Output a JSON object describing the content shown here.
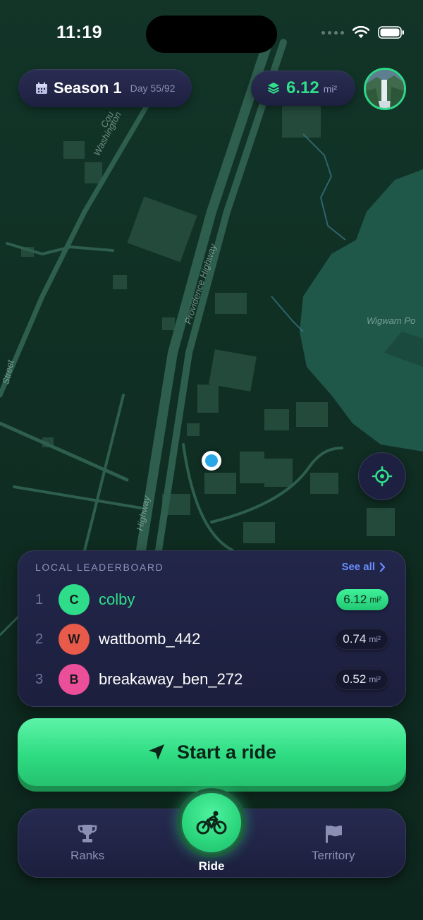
{
  "status_bar": {
    "time": "11:19"
  },
  "header": {
    "season_title": "Season 1",
    "season_day": "Day 55/92",
    "area_value": "6.12",
    "area_unit": "mi²"
  },
  "map": {
    "labels": [
      "Washington",
      "Providence Highway",
      "Wigwam Po",
      "Street",
      "Highway",
      "Cou"
    ]
  },
  "leaderboard": {
    "title": "LOCAL LEADERBOARD",
    "see_all": "See all",
    "rows": [
      {
        "rank": "1",
        "initial": "C",
        "name": "colby",
        "value": "6.12",
        "unit": "mi²",
        "avatar_color": "#2fdc8a",
        "highlight": true
      },
      {
        "rank": "2",
        "initial": "W",
        "name": "wattbomb_442",
        "value": "0.74",
        "unit": "mi²",
        "avatar_color": "#e85a4a",
        "highlight": false
      },
      {
        "rank": "3",
        "initial": "B",
        "name": "breakaway_ben_272",
        "value": "0.52",
        "unit": "mi²",
        "avatar_color": "#ec4f9a",
        "highlight": false
      }
    ]
  },
  "start_ride": {
    "label": "Start a ride"
  },
  "tabbar": {
    "ranks": "Ranks",
    "ride": "Ride",
    "territory": "Territory"
  },
  "icons": {
    "calendar": "calendar-icon",
    "layers": "layers-icon",
    "navigate": "navigation-arrow-icon",
    "crosshair": "crosshair-icon",
    "trophy": "trophy-icon",
    "bike": "bicycle-icon",
    "flag": "flag-icon"
  },
  "colors": {
    "accent_green": "#2fe08a",
    "link_blue": "#6a8dff",
    "panel": "#1c1f3d"
  }
}
